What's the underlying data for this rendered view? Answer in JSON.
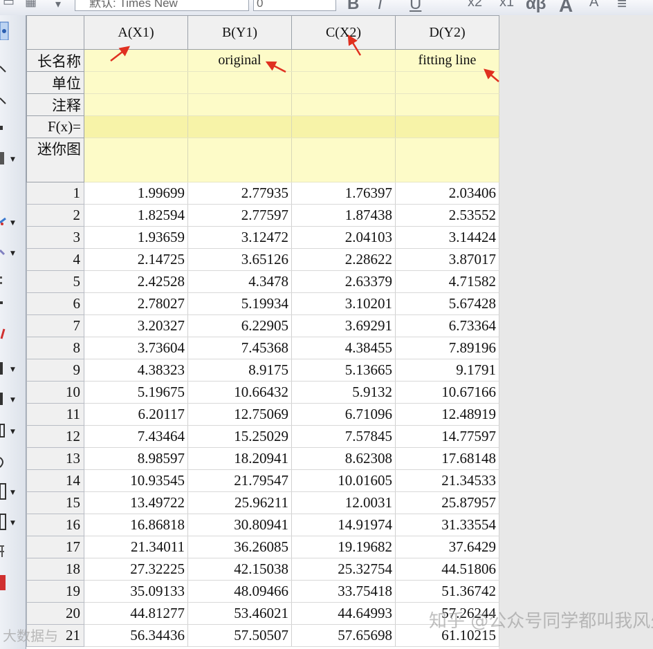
{
  "toolbar": {
    "font_name": "默认: Times New",
    "font_size": "0",
    "format_buttons": [
      "B",
      "I",
      "U",
      "x2",
      "x1",
      "αβ",
      "A",
      "A",
      "≡"
    ]
  },
  "worksheet": {
    "columns": [
      "A(X1)",
      "B(Y1)",
      "C(X2)",
      "D(Y2)"
    ],
    "meta_rows": [
      {
        "label": "长名称",
        "values": [
          "",
          "original",
          "",
          "fitting line"
        ]
      },
      {
        "label": "单位",
        "values": [
          "",
          "",
          "",
          ""
        ]
      },
      {
        "label": "注释",
        "values": [
          "",
          "",
          "",
          ""
        ]
      },
      {
        "label": "F(x)=",
        "values": [
          "",
          "",
          "",
          ""
        ]
      },
      {
        "label": "迷你图",
        "values": [
          "",
          "",
          "",
          ""
        ]
      }
    ],
    "rows": [
      {
        "n": "1",
        "values": [
          "1.99699",
          "2.77935",
          "1.76397",
          "2.03406"
        ]
      },
      {
        "n": "2",
        "values": [
          "1.82594",
          "2.77597",
          "1.87438",
          "2.53552"
        ]
      },
      {
        "n": "3",
        "values": [
          "1.93659",
          "3.12472",
          "2.04103",
          "3.14424"
        ]
      },
      {
        "n": "4",
        "values": [
          "2.14725",
          "3.65126",
          "2.28622",
          "3.87017"
        ]
      },
      {
        "n": "5",
        "values": [
          "2.42528",
          "4.3478",
          "2.63379",
          "4.71582"
        ]
      },
      {
        "n": "6",
        "values": [
          "2.78027",
          "5.19934",
          "3.10201",
          "5.67428"
        ]
      },
      {
        "n": "7",
        "values": [
          "3.20327",
          "6.22905",
          "3.69291",
          "6.73364"
        ]
      },
      {
        "n": "8",
        "values": [
          "3.73604",
          "7.45368",
          "4.38455",
          "7.89196"
        ]
      },
      {
        "n": "9",
        "values": [
          "4.38323",
          "8.9175",
          "5.13665",
          "9.1791"
        ]
      },
      {
        "n": "10",
        "values": [
          "5.19675",
          "10.66432",
          "5.9132",
          "10.67166"
        ]
      },
      {
        "n": "11",
        "values": [
          "6.20117",
          "12.75069",
          "6.71096",
          "12.48919"
        ]
      },
      {
        "n": "12",
        "values": [
          "7.43464",
          "15.25029",
          "7.57845",
          "14.77597"
        ]
      },
      {
        "n": "13",
        "values": [
          "8.98597",
          "18.20941",
          "8.62308",
          "17.68148"
        ]
      },
      {
        "n": "14",
        "values": [
          "10.93545",
          "21.79547",
          "10.01605",
          "21.34533"
        ]
      },
      {
        "n": "15",
        "values": [
          "13.49722",
          "25.96211",
          "12.0031",
          "25.87957"
        ]
      },
      {
        "n": "16",
        "values": [
          "16.86818",
          "30.80941",
          "14.91974",
          "31.33554"
        ]
      },
      {
        "n": "17",
        "values": [
          "21.34011",
          "36.26085",
          "19.19682",
          "37.6429"
        ]
      },
      {
        "n": "18",
        "values": [
          "27.32225",
          "42.15038",
          "25.32754",
          "44.51806"
        ]
      },
      {
        "n": "19",
        "values": [
          "35.09133",
          "48.09466",
          "33.75418",
          "51.36742"
        ]
      },
      {
        "n": "20",
        "values": [
          "44.81277",
          "53.46021",
          "44.64993",
          "57.26244"
        ]
      },
      {
        "n": "21",
        "values": [
          "56.34436",
          "57.50507",
          "57.65698",
          "61.10215"
        ]
      }
    ]
  },
  "watermark": {
    "right_text": "知乎 @公众号同学都叫我风少",
    "left_text": "大数据与"
  },
  "colors": {
    "meta_bg": "#fdfbc8",
    "fx_bg": "#f7f3a8",
    "header_bg": "#f0f0f0",
    "arrow": "#e03020"
  }
}
